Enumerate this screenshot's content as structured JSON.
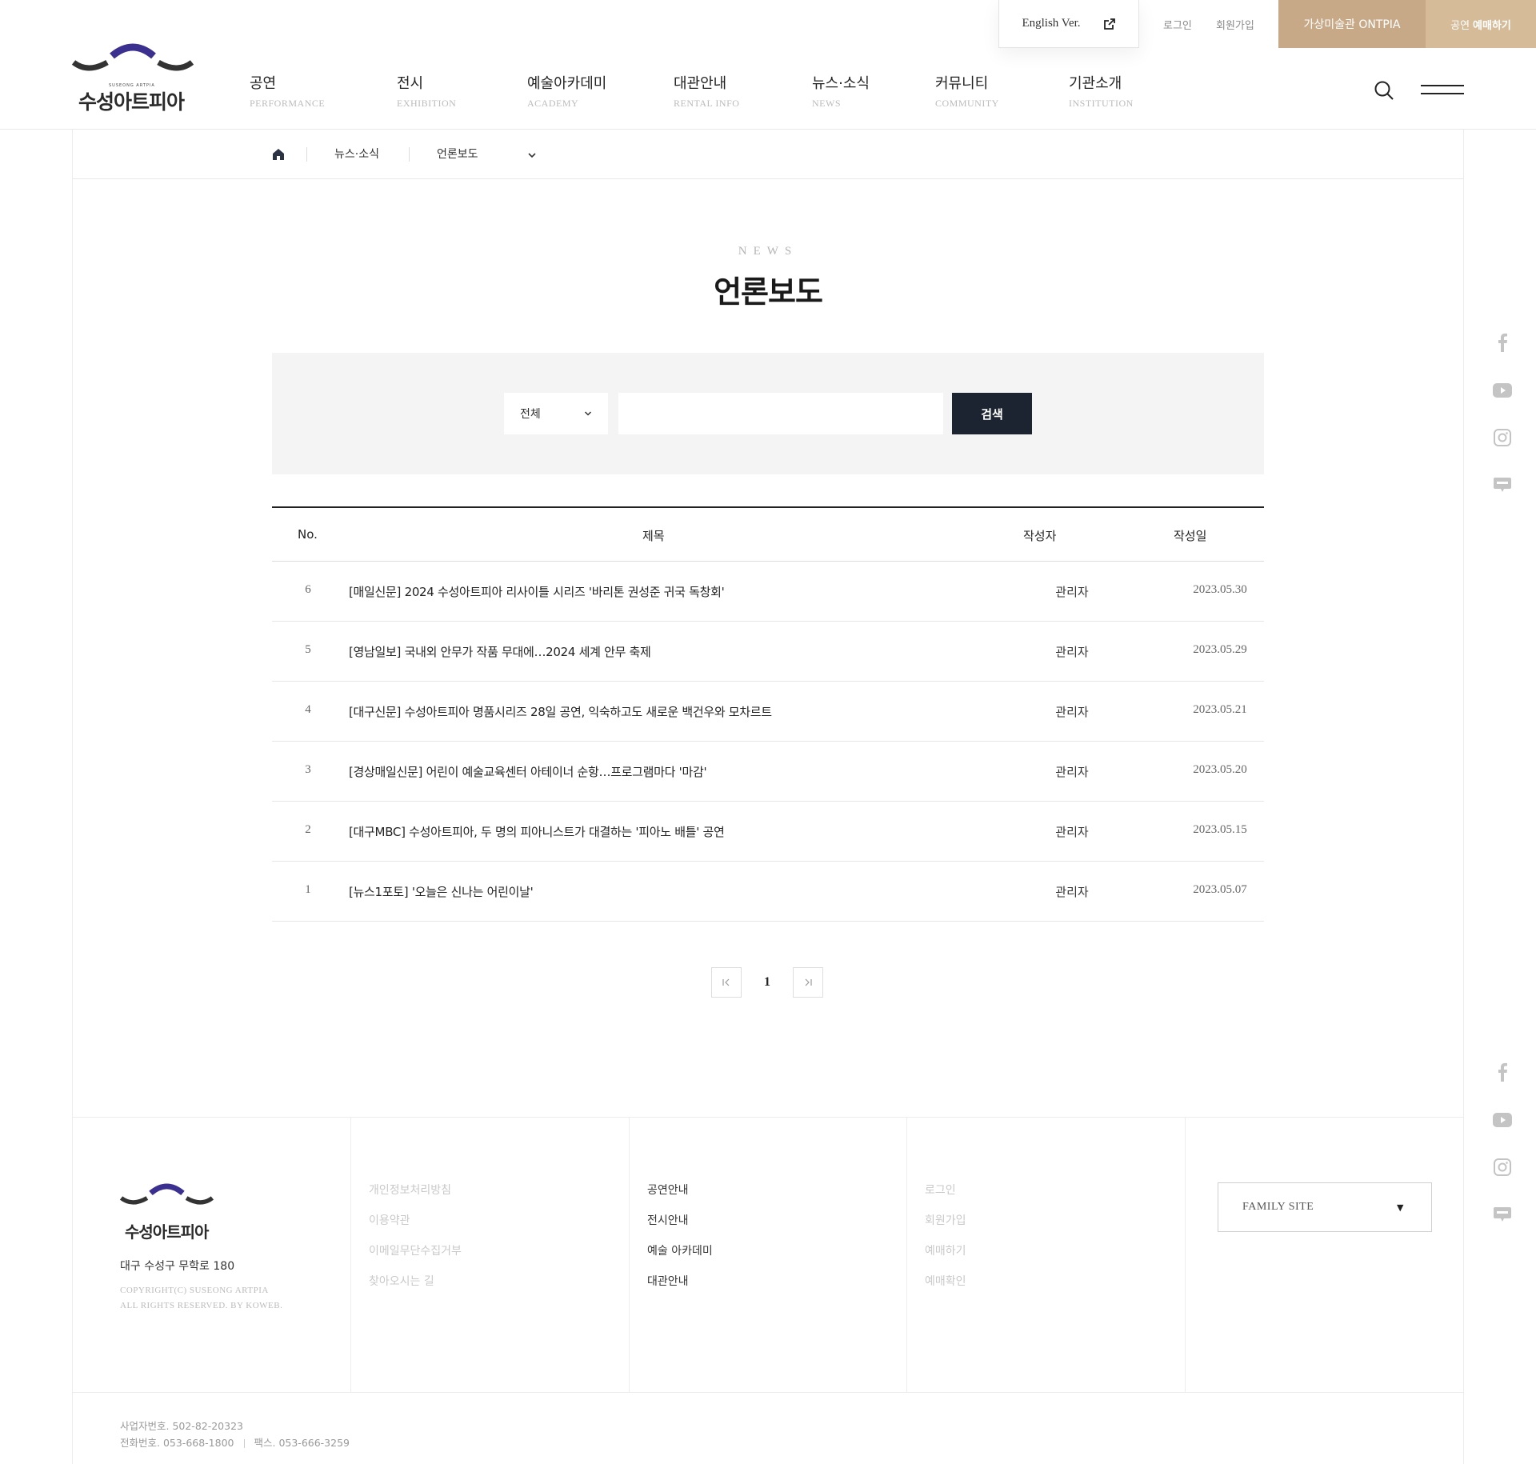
{
  "topbar": {
    "english": "English Ver.",
    "login": "로그인",
    "signup": "회원가입",
    "ontpia": "가상미술관 ONTPIA",
    "ticket_prefix": "공연",
    "ticket_bold": "예매하기"
  },
  "logo": {
    "text": "수성아트피아",
    "sub": "SUSEONG ARTPIA"
  },
  "nav": [
    {
      "ko": "공연",
      "en": "PERFORMANCE"
    },
    {
      "ko": "전시",
      "en": "EXHIBITION"
    },
    {
      "ko": "예술아카데미",
      "en": "ACADEMY"
    },
    {
      "ko": "대관안내",
      "en": "RENTAL INFO"
    },
    {
      "ko": "뉴스·소식",
      "en": "NEWS"
    },
    {
      "ko": "커뮤니티",
      "en": "COMMUNITY"
    },
    {
      "ko": "기관소개",
      "en": "INSTITUTION"
    }
  ],
  "breadcrumb": {
    "level1": "뉴스·소식",
    "level2": "언론보도"
  },
  "page": {
    "eyebrow": "NEWS",
    "title": "언론보도"
  },
  "search": {
    "category": "전체",
    "query": "",
    "button": "검색"
  },
  "table": {
    "headers": {
      "no": "No.",
      "subject": "제목",
      "author": "작성자",
      "date": "작성일"
    },
    "rows": [
      {
        "no": "6",
        "subject": "[매일신문] 2024 수성아트피아 리사이틀 시리즈 '바리톤 권성준 귀국 독창회'",
        "author": "관리자",
        "date": "2023.05.30"
      },
      {
        "no": "5",
        "subject": "[영남일보] 국내외 안무가 작품 무대에…2024 세계 안무 축제",
        "author": "관리자",
        "date": "2023.05.29"
      },
      {
        "no": "4",
        "subject": "[대구신문] 수성아트피아 명품시리즈 28일 공연, 익숙하고도 새로운 백건우와 모차르트",
        "author": "관리자",
        "date": "2023.05.21"
      },
      {
        "no": "3",
        "subject": "[경상매일신문] 어린이 예술교육센터 아테이너 순항…프로그램마다 '마감'",
        "author": "관리자",
        "date": "2023.05.20"
      },
      {
        "no": "2",
        "subject": "[대구MBC] 수성아트피아, 두 명의 피아니스트가 대결하는 '피아노 배틀' 공연",
        "author": "관리자",
        "date": "2023.05.15"
      },
      {
        "no": "1",
        "subject": "[뉴스1포토] '오늘은 신나는 어린이날'",
        "author": "관리자",
        "date": "2023.05.07"
      }
    ]
  },
  "pagination": {
    "current": "1"
  },
  "footer": {
    "address": "대구 수성구 무학로 180",
    "copyright_line1": "COPYRIGHT(C) SUSEONG ARTPIA",
    "copyright_line2": "ALL RIGHTS RESERVED. BY KOWEB.",
    "col1": [
      "개인정보처리방침",
      "이용약관",
      "이메일무단수집거부",
      "찾아오시는 길"
    ],
    "col2": [
      "공연안내",
      "전시안내",
      "예술 아카데미",
      "대관안내"
    ],
    "col3": [
      "로그인",
      "회원가입",
      "예매하기",
      "예매확인"
    ],
    "family_site": "FAMILY SITE",
    "business_no": "사업자번호. 502-82-20323",
    "phone": "전화번호. 053-668-1800",
    "fax": "팩스. 053-666-3259"
  },
  "colors": {
    "accent_gold": "#c8a987",
    "accent_gold_light": "#d6bb99",
    "button_dark": "#1c2431",
    "logo_purple": "#3b2f8f",
    "logo_dark": "#333333"
  },
  "icons": {
    "social": [
      "facebook-icon",
      "youtube-icon",
      "instagram-icon",
      "blog-icon"
    ]
  }
}
